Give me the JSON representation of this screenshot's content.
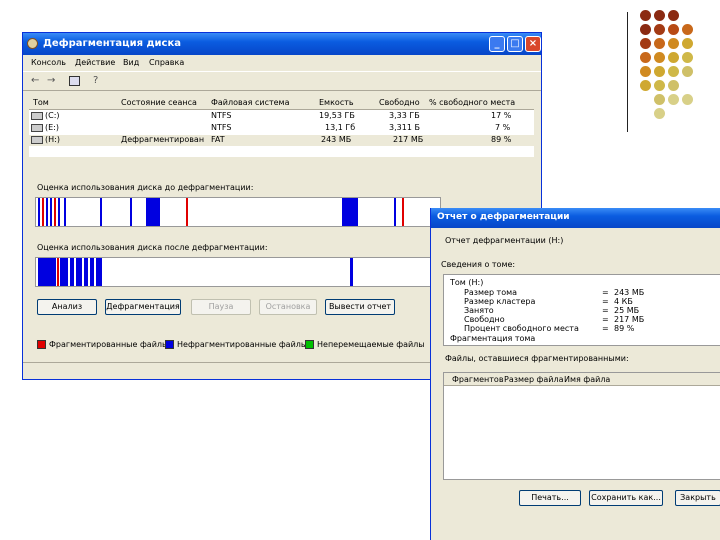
{
  "main_window": {
    "title": "Дефрагментация диска",
    "menu": [
      "Консоль",
      "Действие",
      "Вид",
      "Справка"
    ],
    "columns": [
      "Том",
      "Состояние сеанса",
      "Файловая система",
      "Емкость",
      "Свободно",
      "% свободного места"
    ],
    "volumes": [
      {
        "name": "(C:)",
        "status": "",
        "fs": "NTFS",
        "capacity": "19,53 ГБ",
        "free": "3,33 ГБ",
        "pct": "17 %"
      },
      {
        "name": "(E:)",
        "status": "",
        "fs": "NTFS",
        "capacity": "13,1 Гб",
        "free": "3,311 Б",
        "pct": "7 %"
      },
      {
        "name": "(H:)",
        "status": "Дефрагментирован",
        "fs": "FAT",
        "capacity": "243 МБ",
        "free": "217 МБ",
        "pct": "89 %"
      }
    ],
    "before_label": "Оценка использования диска до дефрагментации:",
    "after_label": "Оценка использования диска после дефрагментации:",
    "buttons": {
      "analyze": "Анализ",
      "defrag": "Дефрагментация",
      "pause": "Пауза",
      "stop": "Остановка",
      "report": "Вывести отчет"
    },
    "legend": [
      {
        "label": "Фрагментированные файлы",
        "color": "#e00000"
      },
      {
        "label": "Нефрагментированные файлы",
        "color": "#0000e0"
      },
      {
        "label": "Неперемещаемые файлы",
        "color": "#00c000"
      }
    ]
  },
  "report": {
    "title": "Отчет о дефрагментации",
    "subtitle": "Отчет дефрагментации (H:)",
    "info_label": "Сведения о томе:",
    "volume_label": "Том (H:)",
    "rows": [
      {
        "label": "Размер тома",
        "value": "243 МБ"
      },
      {
        "label": "Размер кластера",
        "value": "4 КБ"
      },
      {
        "label": "Занято",
        "value": "25 МБ"
      },
      {
        "label": "Свободно",
        "value": "217 МБ"
      },
      {
        "label": "Процент свободного места",
        "value": "89 %"
      }
    ],
    "frag_label": "Фрагментация тома",
    "list_label": "Файлы, оставшиеся фрагментированными:",
    "list_columns": [
      "Фрагментов",
      "Размер файла",
      "Имя файла"
    ],
    "buttons": {
      "print": "Печать...",
      "save": "Сохранить как...",
      "close": "Закрыть"
    }
  },
  "colors": {
    "title_blue": "#0a5ce0",
    "frag_red": "#e00000",
    "contig_blue": "#0000e0"
  },
  "decor_dots": [
    "#8b2a12",
    "#8b2a12",
    "#8b2a12",
    "#b84a14",
    "#c8681a",
    "#c8681a",
    "#d08a20",
    "#cfa830",
    "#cfc068"
  ]
}
